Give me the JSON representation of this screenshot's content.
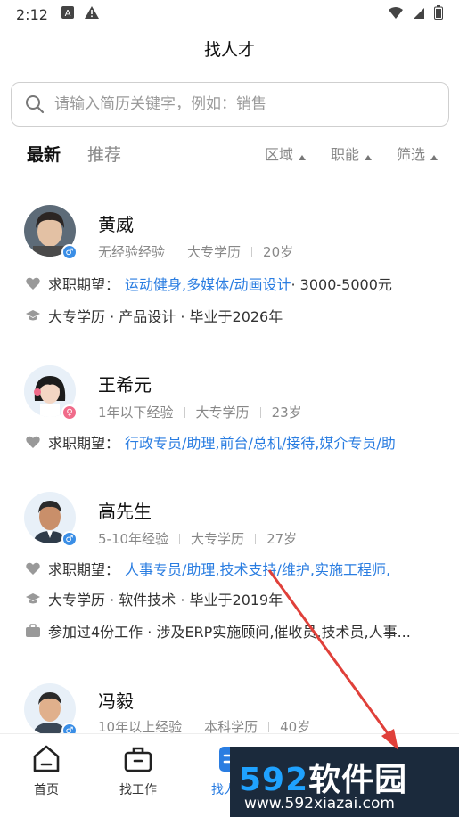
{
  "status_bar": {
    "time": "2:12"
  },
  "title": "找人才",
  "search": {
    "placeholder": "请输入简历关键字，例如：销售"
  },
  "tabs": [
    {
      "label": "最新"
    },
    {
      "label": "推荐"
    }
  ],
  "filters": [
    {
      "label": "区域"
    },
    {
      "label": "职能"
    },
    {
      "label": "筛选"
    }
  ],
  "candidates": [
    {
      "name": "黄威",
      "gender": "male",
      "meta": [
        "无经验经验",
        "大专学历",
        "20岁"
      ],
      "expect_label": "求职期望：",
      "expect_jobs": "运动健身,多媒体/动画设计",
      "expect_salary": " · 3000-5000元",
      "education_line": "大专学历 · 产品设计 · 毕业于2026年"
    },
    {
      "name": "王希元",
      "gender": "female",
      "meta": [
        "1年以下经验",
        "大专学历",
        "23岁"
      ],
      "expect_label": "求职期望：",
      "expect_jobs": "行政专员/助理,前台/总机/接待,媒介专员/助"
    },
    {
      "name": "高先生",
      "gender": "male",
      "meta": [
        "5-10年经验",
        "大专学历",
        "27岁"
      ],
      "expect_label": "求职期望：",
      "expect_jobs": "人事专员/助理,技术支持/维护,实施工程师,",
      "education_line": "大专学历 · 软件技术 · 毕业于2019年",
      "work_line": "参加过4份工作 · 涉及ERP实施顾问,催收员,技术员,人事..."
    },
    {
      "name": "冯毅",
      "gender": "male",
      "meta": [
        "10年以上经验",
        "本科学历",
        "40岁"
      ]
    }
  ],
  "bottom_nav": [
    {
      "label": "首页",
      "icon": "home-icon"
    },
    {
      "label": "找工作",
      "icon": "briefcase-icon"
    },
    {
      "label": "找人才",
      "icon": "talent-icon"
    }
  ],
  "watermark": {
    "brand_num": "592",
    "brand_cn": "软件园",
    "url": "www.592xiazai.com"
  },
  "colors": {
    "accent": "#2a7de1",
    "male": "#3a8ee6",
    "female": "#f06b8a"
  }
}
